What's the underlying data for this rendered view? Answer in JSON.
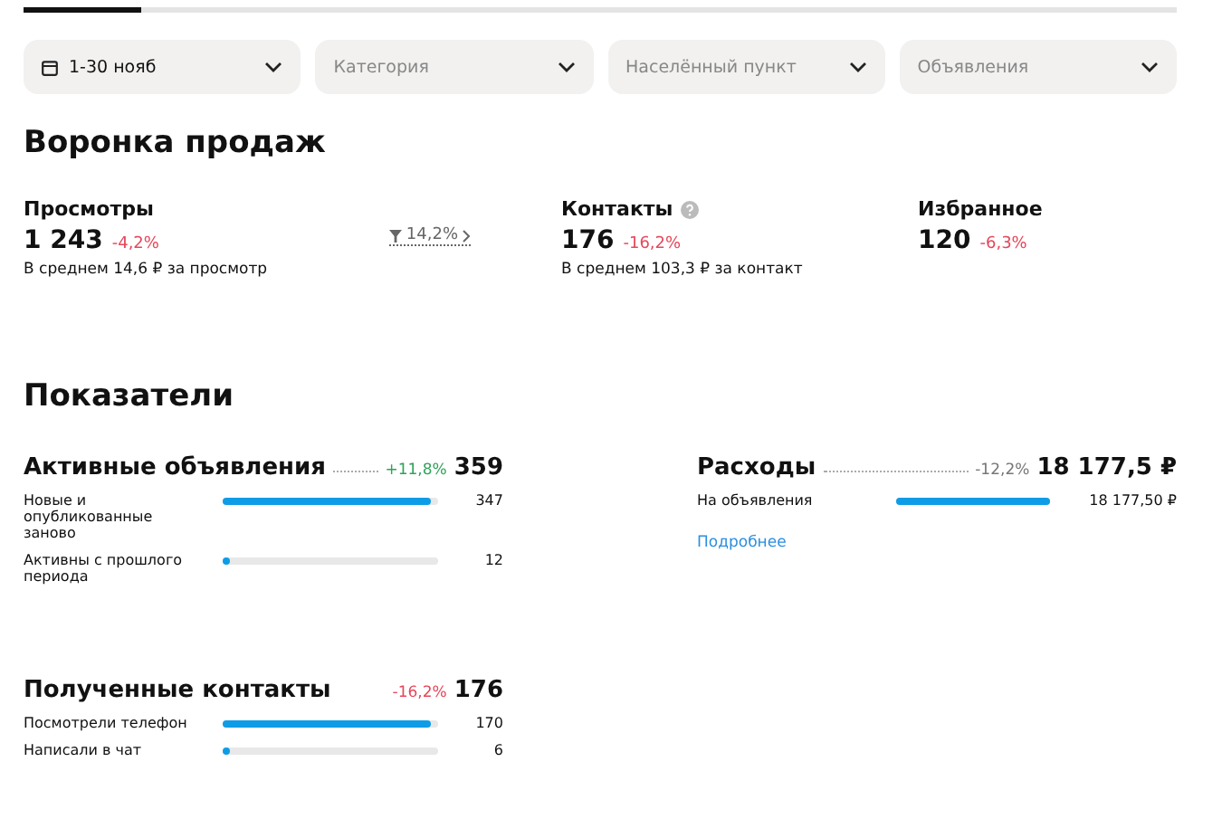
{
  "tabs": [
    {
      "selected": true
    },
    {
      "selected": false
    }
  ],
  "filters": [
    {
      "value": "1-30 нояб",
      "kind": "date"
    },
    {
      "placeholder": "Категория",
      "kind": "select"
    },
    {
      "placeholder": "Населённый пункт",
      "kind": "select"
    },
    {
      "placeholder": "Объявления",
      "kind": "select"
    }
  ],
  "funnel": {
    "title": "Воронка продаж",
    "metrics": [
      {
        "label": "Просмотры",
        "value": "1 243",
        "change": "-4,2%",
        "color": "#e5485b",
        "note": "В среднем 14,6 ₽ за просмотр",
        "conversion": "14,2%",
        "help": false
      },
      {
        "label": "Контакты",
        "value": "176",
        "change": "-16,2%",
        "color": "#e5485b",
        "note": "В среднем 103,3 ₽ за контакт",
        "help": true
      },
      {
        "label": "Избранное",
        "value": "120",
        "change": "-6,3%",
        "color": "#e5485b",
        "help": false
      }
    ]
  },
  "indicators": {
    "title": "Показатели",
    "blocks": [
      {
        "title": "Активные объявления",
        "change": "+11,8%",
        "color": "#2fa35a",
        "total": "359",
        "dotted": true,
        "rows": [
          {
            "label": "Новые и опубликованные заново",
            "level": 0.97,
            "value": "347"
          },
          {
            "label": "Активны с прошлого периода",
            "level": 0.03,
            "value": "12"
          }
        ]
      },
      {
        "title": "Расходы",
        "change": "-12,2%",
        "color": "#777777",
        "total": "18 177,5 ₽",
        "dotted": true,
        "rows": [
          {
            "label": "На объявления",
            "level": 1,
            "value": "18 177,50 ₽"
          }
        ],
        "link": "Подробнее"
      },
      {
        "title": "Полученные контакты",
        "change": "-16,2%",
        "color": "#e5485b",
        "total": "176",
        "dotted": false,
        "rows": [
          {
            "label": "Посмотрели телефон",
            "level": 0.97,
            "value": "170"
          },
          {
            "label": "Написали в чат",
            "level": 0.03,
            "value": "6"
          }
        ]
      }
    ]
  }
}
